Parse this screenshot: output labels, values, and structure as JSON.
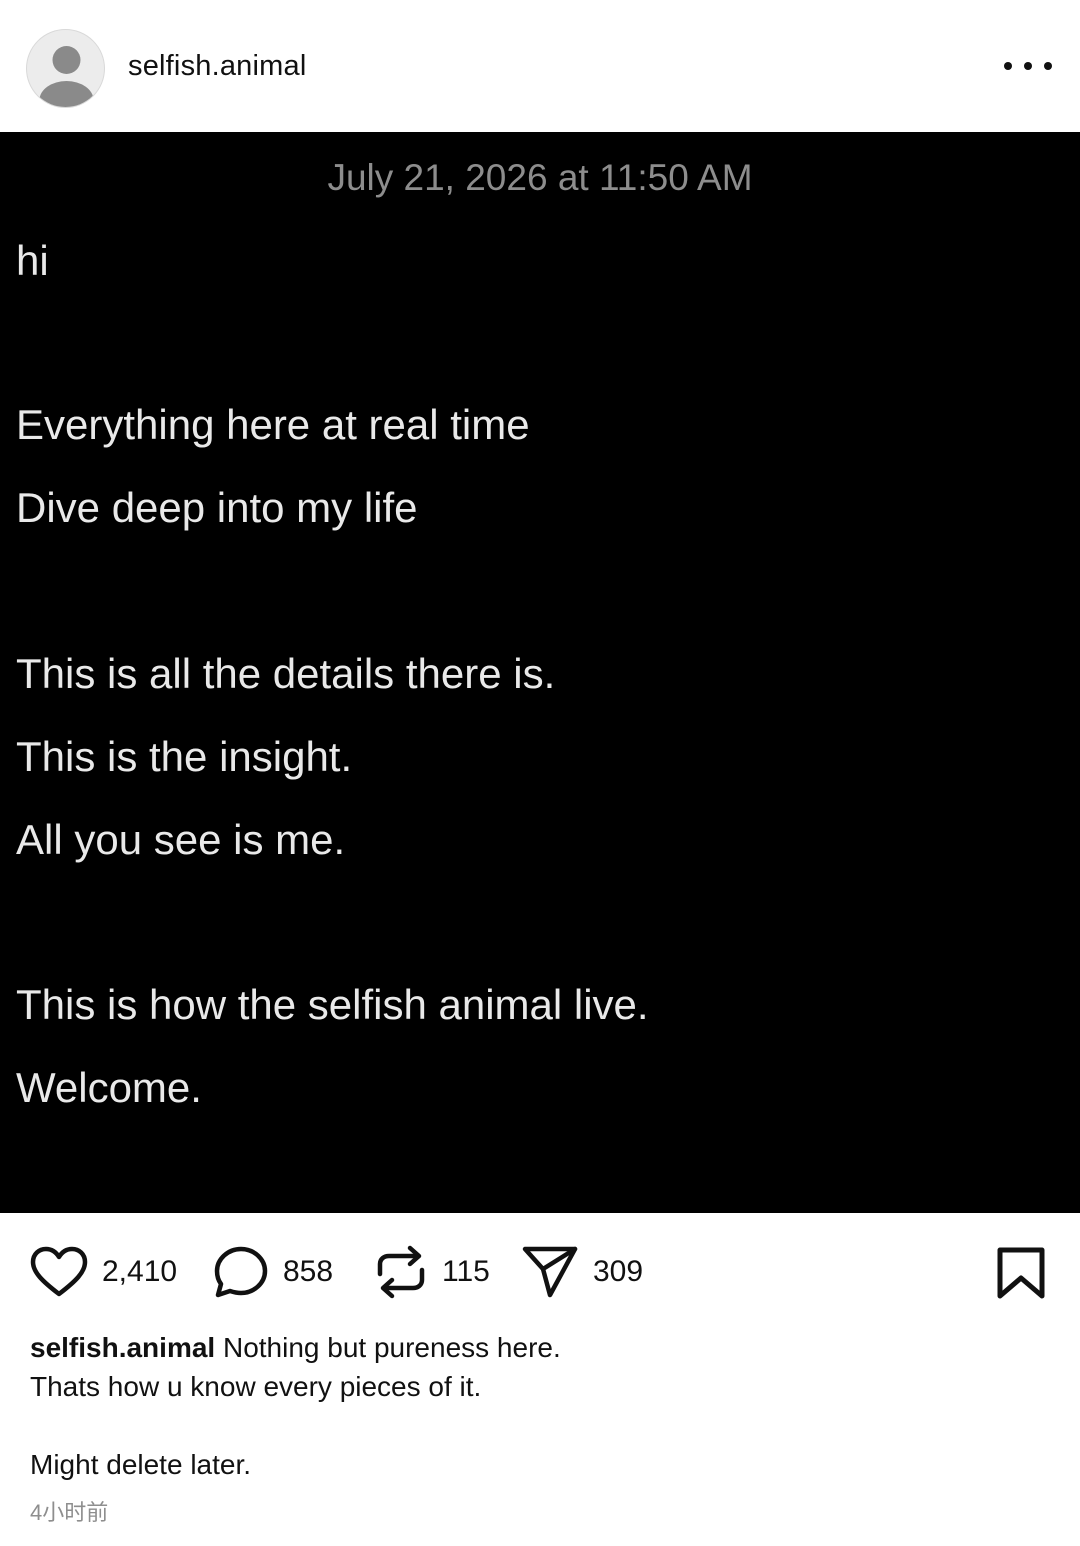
{
  "header": {
    "username": "selfish.animal",
    "avatar_icon": "default-avatar-icon",
    "more_icon": "more-horizontal-icon"
  },
  "post": {
    "date": "July 21, 2026 at 11:50 AM",
    "lines": [
      "hi",
      "Everything here at real time",
      "Dive deep into my life",
      "This is all the details there is.",
      "This is the insight.",
      "All you see is me.",
      "This is how the selfish animal live.",
      "Welcome."
    ]
  },
  "actions": {
    "likes": "2,410",
    "comments": "858",
    "reposts": "115",
    "shares": "309",
    "icons": [
      "heart-icon",
      "comment-icon",
      "repost-icon",
      "send-icon",
      "bookmark-icon"
    ]
  },
  "caption": {
    "author": "selfish.animal",
    "line1": "Nothing but pureness here.",
    "line2": "Thats how u know every pieces of it.",
    "line3": "Might delete later.",
    "time_ago": "4小时前"
  },
  "colors": {
    "background": "#ffffff",
    "post_background": "#000000",
    "post_text": "#e9e9e9",
    "date_text": "#8d8d8d",
    "muted_text": "#8e8e8e"
  }
}
